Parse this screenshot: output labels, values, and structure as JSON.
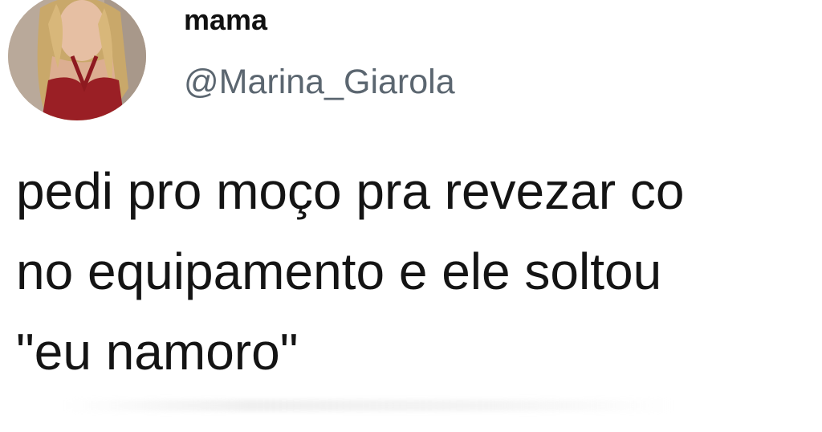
{
  "tweet": {
    "display_name": "mama",
    "handle": "@Marina_Giarola",
    "text_lines": [
      "pedi pro moço pra revezar co",
      "no equipamento e ele soltou",
      "\"eu namoro\""
    ]
  },
  "colors": {
    "name": "#111111",
    "handle": "#5b6670",
    "text": "#141414",
    "background": "#ffffff"
  }
}
